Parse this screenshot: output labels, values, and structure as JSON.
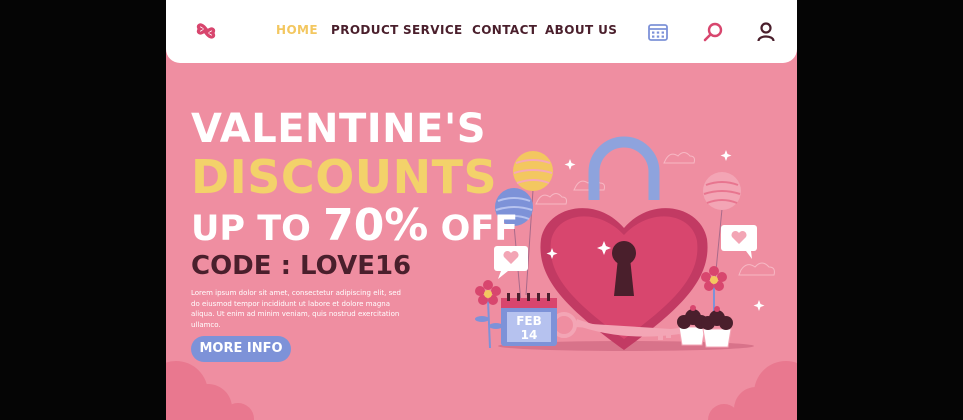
{
  "nav": {
    "items": [
      {
        "label": "HOME",
        "active": true
      },
      {
        "label": "PRODUCT"
      },
      {
        "label": "SERVICE"
      },
      {
        "label": "CONTACT"
      },
      {
        "label": "ABOUT US"
      }
    ],
    "icons": [
      "calendar-icon",
      "search-icon",
      "user-icon"
    ]
  },
  "hero": {
    "line1": "VALENTINE'S",
    "line2": "DISCOUNTS",
    "line3_prefix": "UP TO",
    "line3_percent": "70%",
    "line3_suffix": "OFF",
    "code": "CODE : LOVE16",
    "description": "Lorem ipsum dolor sit amet, consectetur adipiscing elit, sed do eiusmod tempor incididunt ut labore et dolore magna aliqua. Ut enim ad minim veniam, quis nostrud exercitation ullamco.",
    "button_label": "MORE INFO"
  },
  "calendar": {
    "month": "FEB",
    "day": "14"
  },
  "colors": {
    "background": "#ef8ea1",
    "accent_yellow": "#f3d26a",
    "dark_text": "#4a1f2c",
    "button_blue": "#7d92d8",
    "heart": "#d8466e"
  }
}
